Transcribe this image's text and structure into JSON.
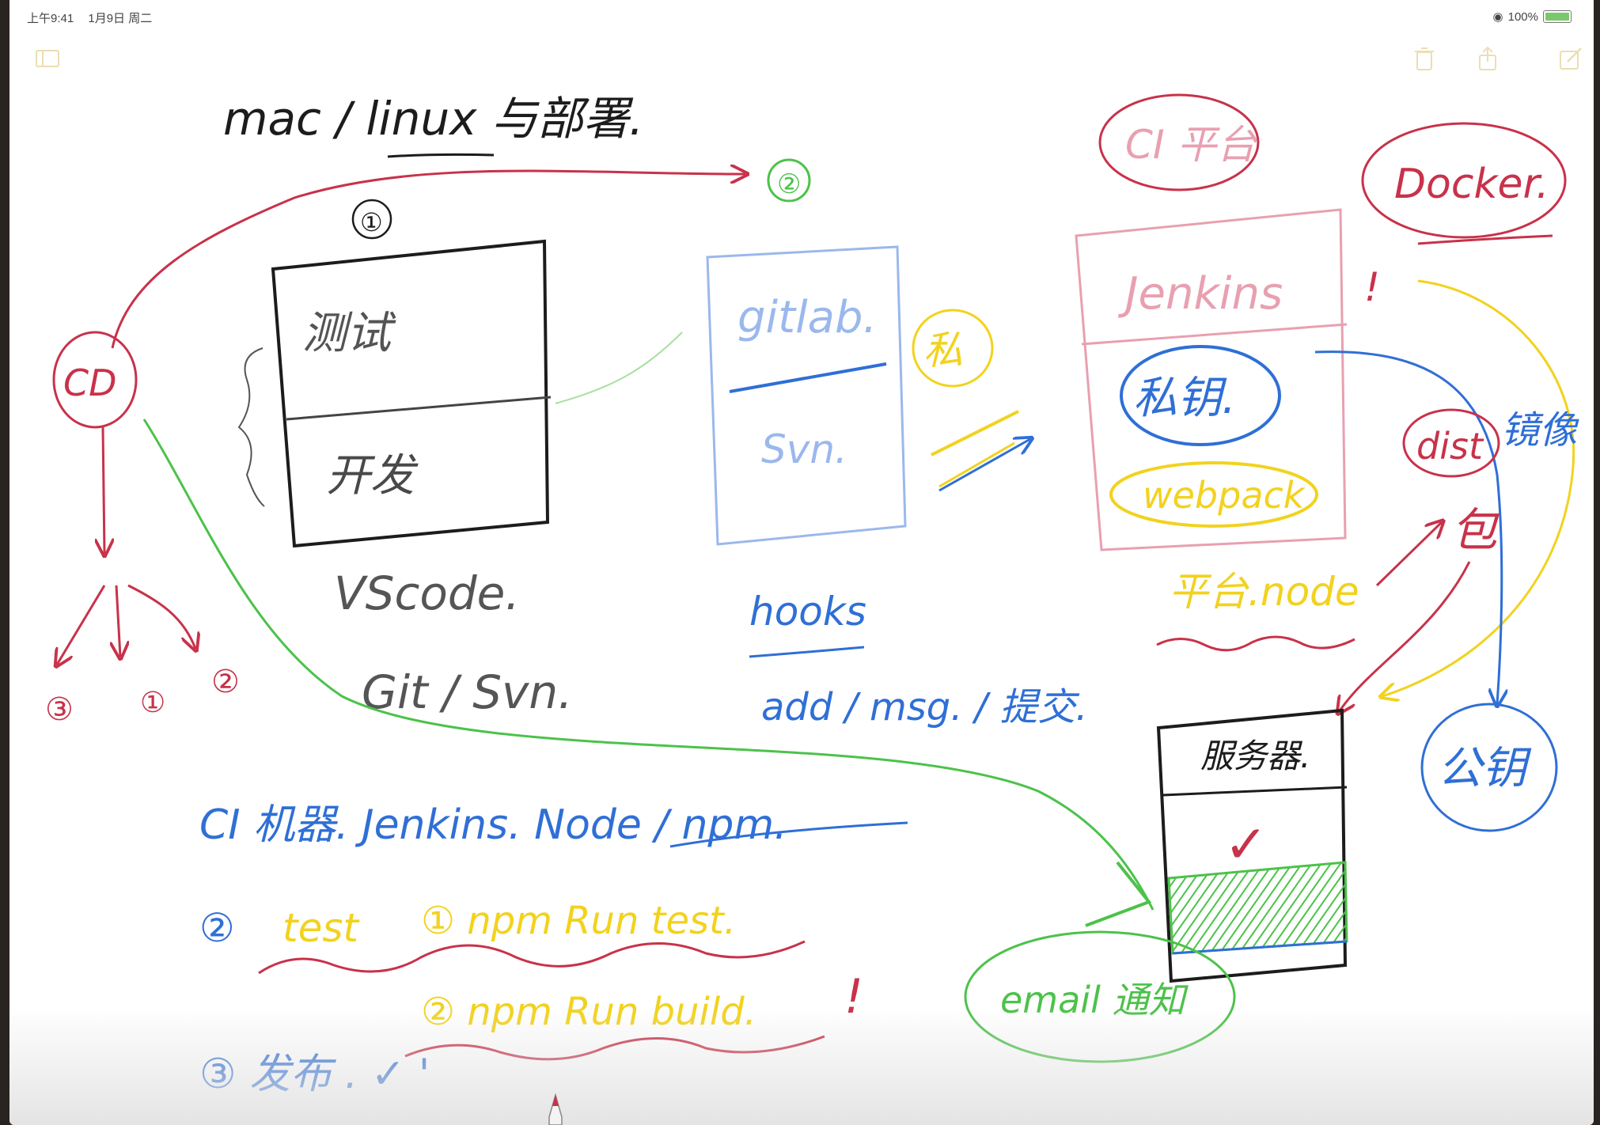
{
  "status_bar": {
    "time": "上午9:41",
    "date": "1月9日 周二",
    "battery": "100%"
  },
  "colors": {
    "red": "#c8324a",
    "blue": "#2f6fd6",
    "green": "#4cc24a",
    "yellow": "#f2d21e",
    "black": "#1c1c1c",
    "pink": "#e8a0b0",
    "lightblue": "#9bb8ec"
  },
  "notes": {
    "title": "mac / linux 与部署.",
    "circle1": "①",
    "circle2": "②",
    "box1_top": "测试",
    "box1_bottom": "开发",
    "vscode": "VScode.",
    "git_svn": "Git / Svn.",
    "gitlab": "gitlab.",
    "svn": "Svn.",
    "hooks": "hooks",
    "add_msg": "add / msg. / 提交.",
    "si": "私",
    "ci": "CI 平台",
    "jenkins": "Jenkins",
    "private_key": "私钥.",
    "webpack": "webpack",
    "platform_node": "平台.node",
    "docker": "Docker.",
    "dist": "dist",
    "box": "包",
    "mirror": "镜像",
    "public_key": "公钥",
    "server": "服务器.",
    "check": "✓",
    "cd": "CD",
    "cd_n3": "③",
    "cd_n1": "①",
    "cd_n2": "②",
    "step1": "CI 机器. Jenkins. Node / npm.",
    "step2_label": "test",
    "step2_a": "① npm Run test.",
    "step2_b": "② npm Run build.",
    "step3": "③ 发布 . ✓ '",
    "email": "email 通知",
    "warn": "!"
  }
}
